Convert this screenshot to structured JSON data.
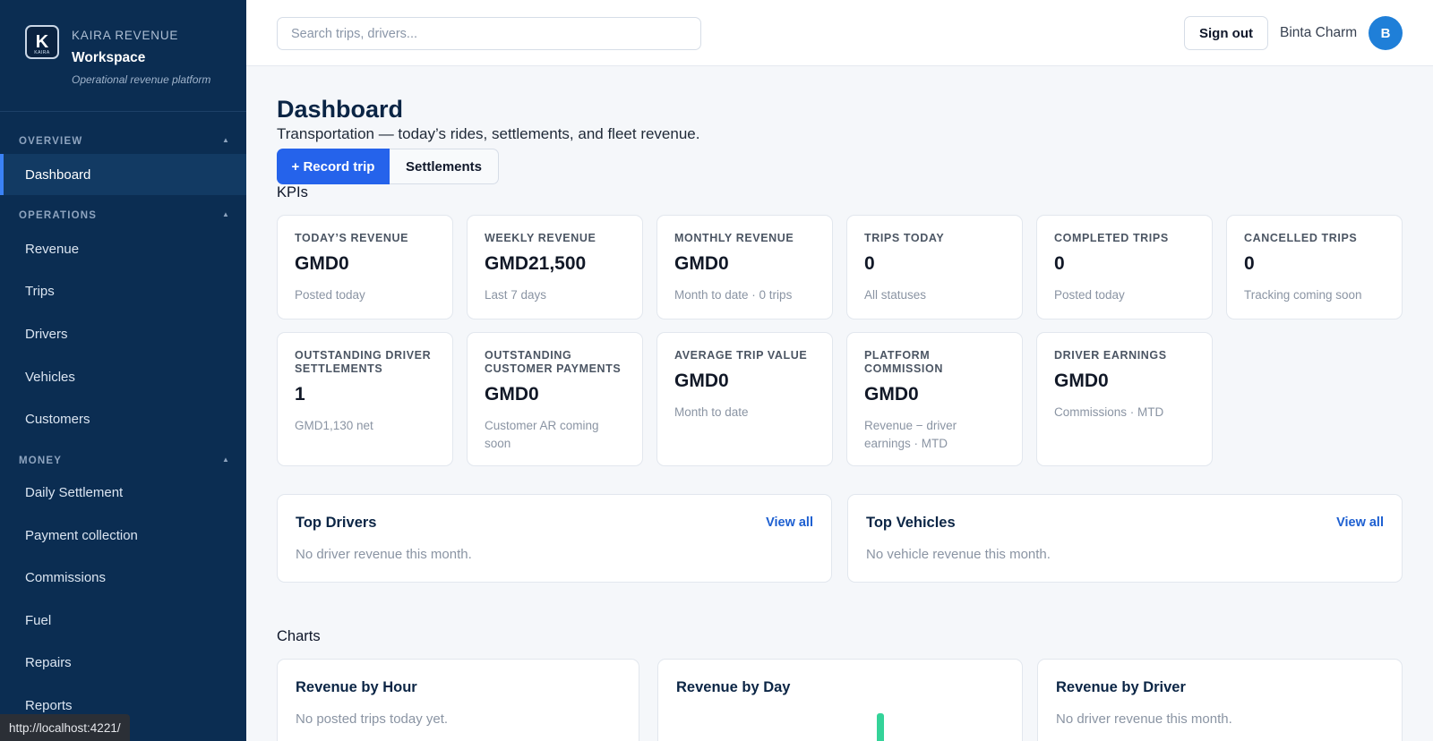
{
  "brand": {
    "name": "KAIRA REVENUE",
    "workspace": "Workspace",
    "tagline": "Operational revenue platform",
    "logo_text": "K",
    "logo_subtext": "KAIRA"
  },
  "sidebar": {
    "sections": [
      {
        "label": "OVERVIEW",
        "items": [
          {
            "label": "Dashboard",
            "active": true
          }
        ]
      },
      {
        "label": "OPERATIONS",
        "items": [
          {
            "label": "Revenue"
          },
          {
            "label": "Trips"
          },
          {
            "label": "Drivers"
          },
          {
            "label": "Vehicles"
          },
          {
            "label": "Customers"
          }
        ]
      },
      {
        "label": "MONEY",
        "items": [
          {
            "label": "Daily Settlement"
          },
          {
            "label": "Payment collection"
          },
          {
            "label": "Commissions"
          },
          {
            "label": "Fuel"
          },
          {
            "label": "Repairs"
          },
          {
            "label": "Reports"
          }
        ]
      }
    ],
    "caret": "▲",
    "accent_color": "#3b82f6"
  },
  "topbar": {
    "search_placeholder": "Search trips, drivers...",
    "sign_out": "Sign out",
    "user_name": "Binta Charm",
    "avatar_initial": "B"
  },
  "page": {
    "title": "Dashboard",
    "subtitle": "Transportation — today’s rides, settlements, and fleet revenue.",
    "primary_action": "+ Record trip",
    "secondary_action": "Settlements",
    "kpis_label": "KPIs",
    "charts_label": "Charts"
  },
  "kpis": [
    {
      "label": "TODAY’S REVENUE",
      "value": "GMD0",
      "sub": "Posted today"
    },
    {
      "label": "WEEKLY REVENUE",
      "value": "GMD21,500",
      "sub": "Last 7 days"
    },
    {
      "label": "MONTHLY REVENUE",
      "value": "GMD0",
      "sub": "Month to date · 0 trips"
    },
    {
      "label": "TRIPS TODAY",
      "value": "0",
      "sub": "All statuses"
    },
    {
      "label": "COMPLETED TRIPS",
      "value": "0",
      "sub": "Posted today"
    },
    {
      "label": "CANCELLED TRIPS",
      "value": "0",
      "sub": "Tracking coming soon"
    },
    {
      "label": "OUTSTANDING DRIVER SETTLEMENTS",
      "value": "1",
      "sub": "GMD1,130 net"
    },
    {
      "label": "OUTSTANDING CUSTOMER PAYMENTS",
      "value": "GMD0",
      "sub": "Customer AR coming soon"
    },
    {
      "label": "AVERAGE TRIP VALUE",
      "value": "GMD0",
      "sub": "Month to date"
    },
    {
      "label": "PLATFORM COMMISSION",
      "value": "GMD0",
      "sub": "Revenue − driver earnings · MTD"
    },
    {
      "label": "DRIVER EARNINGS",
      "value": "GMD0",
      "sub": "Commissions · MTD"
    }
  ],
  "top_drivers": {
    "title": "Top Drivers",
    "link": "View all",
    "empty": "No driver revenue this month."
  },
  "top_vehicles": {
    "title": "Top Vehicles",
    "link": "View all",
    "empty": "No vehicle revenue this month."
  },
  "charts": {
    "by_hour": {
      "title": "Revenue by Hour",
      "empty": "No posted trips today yet."
    },
    "by_day": {
      "title": "Revenue by Day",
      "bar_color": "#34d399"
    },
    "by_driver": {
      "title": "Revenue by Driver",
      "empty": "No driver revenue this month."
    }
  },
  "status_url": "http://localhost:4221/"
}
